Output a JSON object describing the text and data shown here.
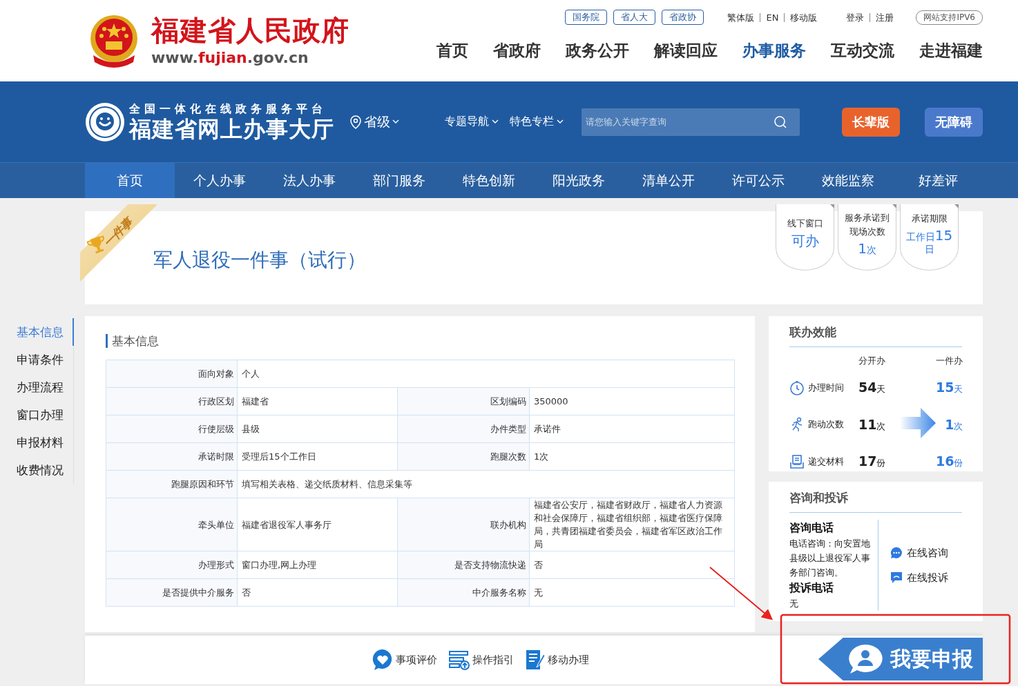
{
  "header": {
    "site_title": "福建省人民政府",
    "domain": [
      {
        "text": "www.",
        "highlight": false
      },
      {
        "text": "fujian",
        "highlight": true
      },
      {
        "text": ".gov.cn",
        "highlight": false
      }
    ],
    "org_links": [
      "国务院",
      "省人大",
      "省政协"
    ],
    "lang_links": [
      "繁体版",
      "EN",
      "移动版"
    ],
    "account_links": [
      "登录",
      "注册"
    ],
    "ipv6_badge": "网站支持IPV6",
    "main_nav": [
      {
        "label": "首页",
        "selected": false
      },
      {
        "label": "省政府",
        "selected": false
      },
      {
        "label": "政务公开",
        "selected": false
      },
      {
        "label": "解读回应",
        "selected": false
      },
      {
        "label": "办事服务",
        "selected": true
      },
      {
        "label": "互动交流",
        "selected": false
      },
      {
        "label": "走进福建",
        "selected": false
      }
    ]
  },
  "hall": {
    "platform": "全国一体化在线政务服务平台",
    "name": "福建省网上办事大厅",
    "region": "省级",
    "menus": [
      "专题导航",
      "特色专栏"
    ],
    "search": {
      "placeholder": "请您输入关键字查询"
    },
    "buttons": [
      {
        "label": "长辈版",
        "color": "#e8632b"
      },
      {
        "label": "无障碍",
        "color": "#4a79cc"
      }
    ]
  },
  "nav": [
    {
      "label": "首页",
      "selected": true
    },
    {
      "label": "个人办事",
      "selected": false
    },
    {
      "label": "法人办事",
      "selected": false
    },
    {
      "label": "部门服务",
      "selected": false
    },
    {
      "label": "特色创新",
      "selected": false
    },
    {
      "label": "阳光政务",
      "selected": false
    },
    {
      "label": "清单公开",
      "selected": false
    },
    {
      "label": "许可公示",
      "selected": false
    },
    {
      "label": "效能监察",
      "selected": false
    },
    {
      "label": "好差评",
      "selected": false
    }
  ],
  "banner": {
    "ribbon": "一件事",
    "title": "军人退役一件事（试行）",
    "badges": [
      {
        "label": "线下窗口",
        "value": [
          {
            "text": "可办",
            "big": true
          }
        ]
      },
      {
        "label": "服务承诺到现场次数",
        "value": [
          {
            "text": "1",
            "big": true
          },
          {
            "text": "次",
            "big": false
          }
        ]
      },
      {
        "label": "承诺期限",
        "value": [
          {
            "text": "工作日",
            "big": false
          },
          {
            "text": "15",
            "big": true
          },
          {
            "text": "日",
            "big": false
          }
        ]
      }
    ]
  },
  "side_nav": [
    {
      "label": "基本信息",
      "selected": true
    },
    {
      "label": "申请条件",
      "selected": false
    },
    {
      "label": "办理流程",
      "selected": false
    },
    {
      "label": "窗口办理",
      "selected": false
    },
    {
      "label": "申报材料",
      "selected": false
    },
    {
      "label": "收费情况",
      "selected": false
    }
  ],
  "basic_info": {
    "title": "基本信息",
    "rows": [
      {
        "cells": [
          {
            "label": "面向对象",
            "value": "个人"
          }
        ]
      },
      {
        "cells": [
          {
            "label": "行政区划",
            "value": "福建省"
          },
          {
            "label": "区划编码",
            "value": "350000"
          }
        ]
      },
      {
        "cells": [
          {
            "label": "行使层级",
            "value": "县级"
          },
          {
            "label": "办件类型",
            "value": "承诺件"
          }
        ]
      },
      {
        "cells": [
          {
            "label": "承诺时限",
            "value": "受理后15个工作日"
          },
          {
            "label": "跑腿次数",
            "value": "1次"
          }
        ]
      },
      {
        "cells": [
          {
            "label": "跑腿原因和环节",
            "value": "填写相关表格、递交纸质材料、信息采集等"
          }
        ]
      },
      {
        "cells": [
          {
            "label": "牵头单位",
            "value": "福建省退役军人事务厅"
          },
          {
            "label": "联办机构",
            "value": "福建省公安厅，福建省财政厅，福建省人力资源和社会保障厅，福建省组织部，福建省医疗保障局，共青团福建省委员会，福建省军区政治工作局"
          }
        ]
      },
      {
        "cells": [
          {
            "label": "办理形式",
            "value": "窗口办理,网上办理"
          },
          {
            "label": "是否支持物流快递",
            "value": "否"
          }
        ]
      },
      {
        "cells": [
          {
            "label": "是否提供中介服务",
            "value": "否"
          },
          {
            "label": "中介服务名称",
            "value": "无"
          }
        ]
      }
    ]
  },
  "linked": {
    "title": "联办效能",
    "columns": [
      "分开办",
      "一件办"
    ],
    "rows": [
      {
        "kind": "time",
        "label": "办理时间",
        "separate": {
          "number": "54",
          "unit": "天"
        },
        "combined": {
          "number": "15",
          "unit": "天"
        },
        "arrow": false
      },
      {
        "kind": "visits",
        "label": "跑动次数",
        "separate": {
          "number": "11",
          "unit": "次"
        },
        "combined": {
          "number": "1",
          "unit": "次"
        },
        "arrow": true
      },
      {
        "kind": "materials",
        "label": "递交材料",
        "separate": {
          "number": "17",
          "unit": "份"
        },
        "combined": {
          "number": "16",
          "unit": "份"
        },
        "arrow": false
      }
    ]
  },
  "consult": {
    "title": "咨询和投诉",
    "phone_title": "咨询电话",
    "phone_text": "电话咨询：向安置地县级以上退役军人事务部门咨询。",
    "complaint_title": "投诉电话",
    "complaint_text": "无",
    "links": [
      {
        "kind": "consult",
        "label": "在线咨询"
      },
      {
        "kind": "complain",
        "label": "在线投诉"
      }
    ]
  },
  "bottom": {
    "actions": [
      {
        "kind": "rate",
        "label": "事项评价"
      },
      {
        "kind": "guide",
        "label": "操作指引"
      },
      {
        "kind": "mobile",
        "label": "移动办理"
      }
    ],
    "apply_button": "我要申报"
  }
}
